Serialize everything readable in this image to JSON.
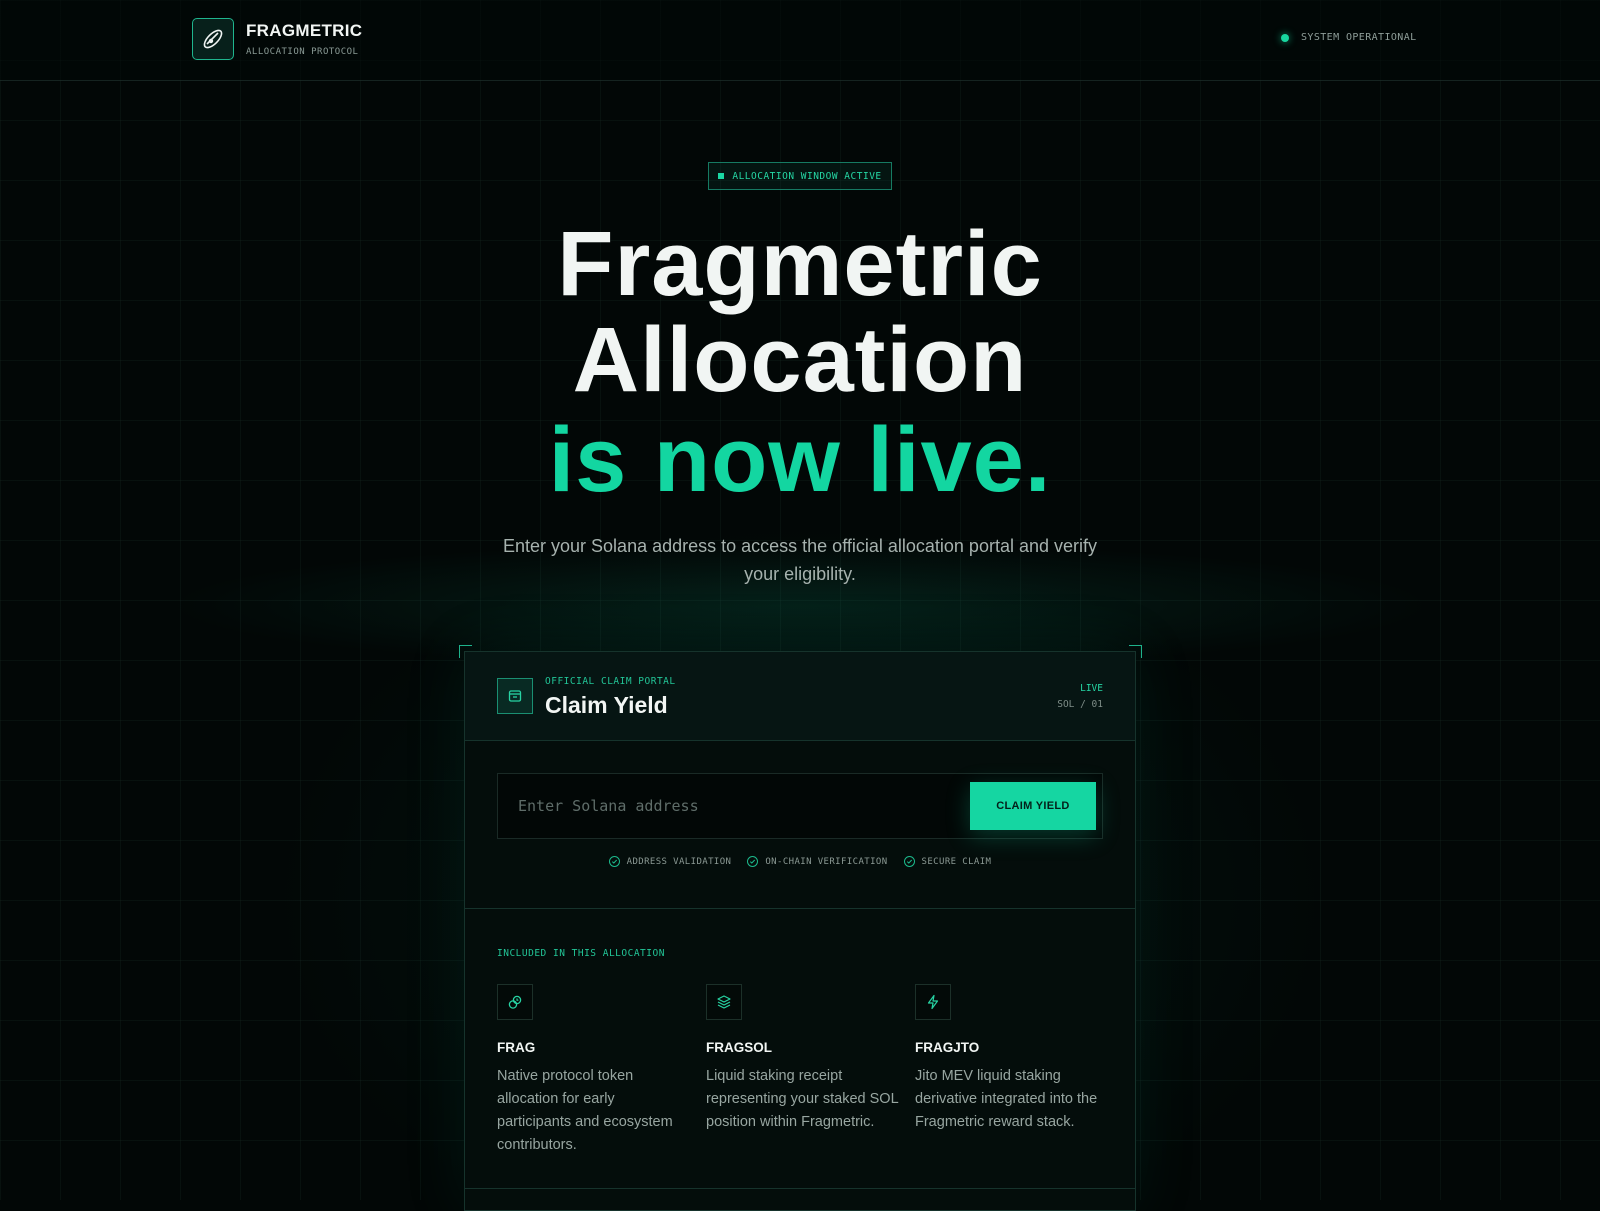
{
  "header": {
    "brand_name": "FRAGMETRIC",
    "brand_subtitle": "ALLOCATION PROTOCOL",
    "status_text": "SYSTEM OPERATIONAL"
  },
  "hero": {
    "badge": "ALLOCATION WINDOW ACTIVE",
    "title_line1": "Fragmetric",
    "title_line2": "Allocation",
    "title_accent": "is now live.",
    "subtitle": "Enter your Solana address to access the official allocation portal and verify your eligibility."
  },
  "card": {
    "eyebrow": "OFFICIAL CLAIM PORTAL",
    "title": "Claim Yield",
    "live_label": "LIVE",
    "network_label": "SOL / 01",
    "input_placeholder": "Enter Solana address",
    "input_value": "",
    "button_label": "CLAIM YIELD",
    "checks": [
      "ADDRESS VALIDATION",
      "ON-CHAIN VERIFICATION",
      "SECURE CLAIM"
    ],
    "included_label": "INCLUDED IN THIS ALLOCATION",
    "assets": [
      {
        "name": "FRAG",
        "icon": "coins-icon",
        "description": "Native protocol token allocation for early participants and ecosystem contributors."
      },
      {
        "name": "FRAGSOL",
        "icon": "layers-icon",
        "description": "Liquid staking receipt representing your staked SOL position within Fragmetric."
      },
      {
        "name": "FRAGJTO",
        "icon": "lightning-icon",
        "description": "Jito MEV liquid staking derivative integrated into the Fragmetric reward stack."
      }
    ]
  },
  "colors": {
    "accent": "#13d6a1",
    "background": "#020706",
    "text": "#f1f5f3",
    "muted": "#a6b2ae"
  }
}
